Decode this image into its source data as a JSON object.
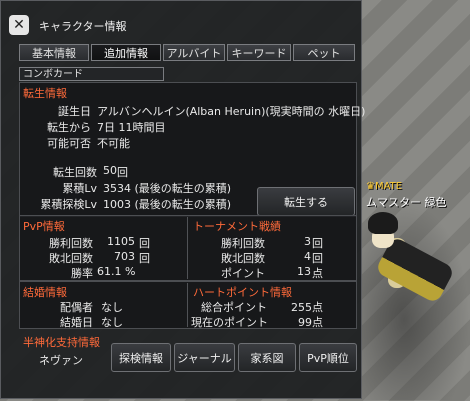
{
  "window": {
    "title": "キャラクター情報",
    "icon": "close-icon"
  },
  "tabs": [
    "基本情報",
    "追加情報",
    "アルバイト",
    "キーワード",
    "ペット"
  ],
  "subtab": "コンボカード",
  "rebirth": {
    "title": "転生情報",
    "birthday_label": "誕生日",
    "birthday": "アルバンヘルイン(Alban Heruin)(現実時間の 水曜日)",
    "since_label": "転生から",
    "since": "7日 11時間目",
    "possible_label": "可能可否",
    "possible": "不可能",
    "count_label": "転生回数",
    "count": "50",
    "count_unit": "回",
    "level_label": "累積Lv",
    "level": "3534 (最後の転生の累積)",
    "explore_label": "累積探検Lv",
    "explore": "1003 (最後の転生の累積)",
    "button": "転生する"
  },
  "pvp": {
    "title": "PvP情報",
    "wins_label": "勝利回数",
    "wins": "1105",
    "wins_unit": "回",
    "losses_label": "敗北回数",
    "losses": "703",
    "losses_unit": "回",
    "rate_label": "勝率",
    "rate": "61.1 %"
  },
  "tournament": {
    "title": "トーナメント戦績",
    "wins_label": "勝利回数",
    "wins": "3",
    "wins_unit": "回",
    "losses_label": "敗北回数",
    "losses": "4",
    "losses_unit": "回",
    "points_label": "ポイント",
    "points": "13",
    "points_unit": "点"
  },
  "marriage": {
    "title": "結婚情報",
    "spouse_label": "配偶者",
    "spouse": "なし",
    "date_label": "結婚日",
    "date": "なし"
  },
  "heart": {
    "title": "ハートポイント情報",
    "total_label": "総合ポイント",
    "total": "255点",
    "current_label": "現在のポイント",
    "current": "99点"
  },
  "support": {
    "title": "半神化支持情報",
    "value": "ネヴァン"
  },
  "buttons": [
    "探検情報",
    "ジャーナル",
    "家系図",
    "PvP順位"
  ],
  "scene": {
    "npc_guild": "MATE",
    "npc_title": "ムマスター 緑色"
  },
  "colors": {
    "section_title": "#ff6a3a",
    "panel_bg": "#1c1e20",
    "guild_tag": "#ffcc33"
  }
}
